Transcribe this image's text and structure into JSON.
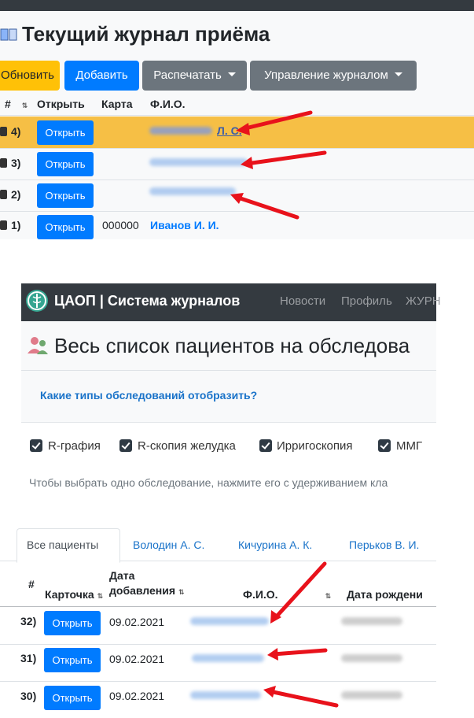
{
  "top_section": {
    "title": "Текущий журнал приёма",
    "toolbar": {
      "refresh": "Обновить",
      "add": "Добавить",
      "print": "Распечатать",
      "manage": "Управление журналом"
    },
    "columns": [
      "#",
      "Открыть",
      "Карта",
      "Ф.И.О."
    ],
    "rows": [
      {
        "num": "4)",
        "open": "Открыть",
        "card": "",
        "name": "Л. С.",
        "highlighted": true
      },
      {
        "num": "3)",
        "open": "Открыть",
        "card": "",
        "name": ""
      },
      {
        "num": "2)",
        "open": "Открыть",
        "card": "",
        "name": ""
      },
      {
        "num": "1)",
        "open": "Открыть",
        "card": "000000",
        "name": "Иванов И. И."
      }
    ],
    "highlight_color": "#f6bf45"
  },
  "bottom_section": {
    "brand": "ЦАОП | Система журналов",
    "nav": [
      "Новости",
      "Профиль",
      "ЖУРН"
    ],
    "title": "Весь список пациентов на обследова",
    "question": "Какие типы обследований отобразить?",
    "checkboxes": [
      "R-графия",
      "R-скопия желудка",
      "Ирригоскопия",
      "ММГ"
    ],
    "hint": "Чтобы выбрать одно обследование, нажмите его с удерживанием кла",
    "tabs": [
      "Все пациенты",
      "Володин А. С.",
      "Кичурина А. К.",
      "Перьков В. И."
    ],
    "columns": {
      "num": "#",
      "card": "Карточка",
      "date_line1": "Дата",
      "date_line2": "добавления",
      "name": "Ф.И.О.",
      "birth": "Дата рождени"
    },
    "rows": [
      {
        "num": "32)",
        "open": "Открыть",
        "date": "09.02.2021"
      },
      {
        "num": "31)",
        "open": "Открыть",
        "date": "09.02.2021"
      },
      {
        "num": "30)",
        "open": "Открыть",
        "date": "09.02.2021"
      }
    ]
  },
  "colors": {
    "primary": "#007bff",
    "warning": "#ffc107",
    "secondary": "#6c757d",
    "dark": "#343a40",
    "arrow": "#e8121b"
  }
}
